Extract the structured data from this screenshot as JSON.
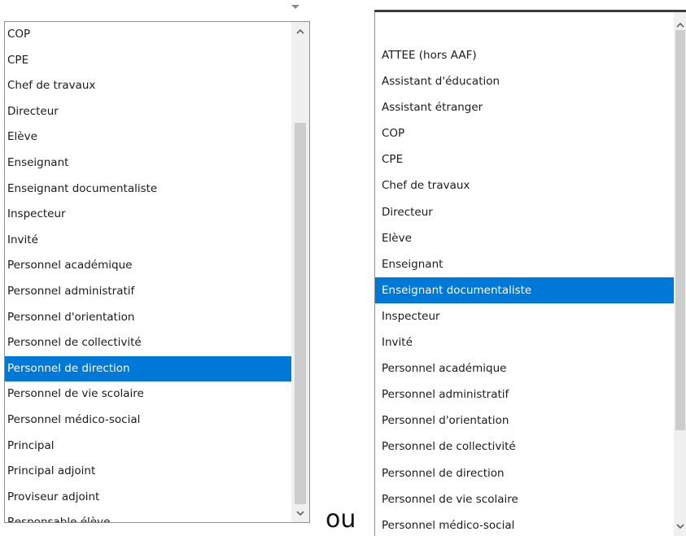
{
  "separator_text": "ou",
  "left_list": {
    "options": [
      "COP",
      "CPE",
      "Chef de travaux",
      "Directeur",
      "Elève",
      "Enseignant",
      "Enseignant documentaliste",
      "Inspecteur",
      "Invité",
      "Personnel académique",
      "Personnel administratif",
      "Personnel d'orientation",
      "Personnel de collectivité",
      "Personnel de direction",
      "Personnel de vie scolaire",
      "Personnel médico-social",
      "Principal",
      "Principal adjoint",
      "Proviseur adjoint",
      "Responsable élève"
    ],
    "selected_index": 13
  },
  "right_list": {
    "options": [
      "ATTEE (hors AAF)",
      "Assistant d'éducation",
      "Assistant étranger",
      "COP",
      "CPE",
      "Chef de travaux",
      "Directeur",
      "Elève",
      "Enseignant",
      "Enseignant documentaliste",
      "Inspecteur",
      "Invité",
      "Personnel académique",
      "Personnel administratif",
      "Personnel d'orientation",
      "Personnel de collectivité",
      "Personnel de direction",
      "Personnel de vie scolaire",
      "Personnel médico-social"
    ],
    "selected_index": 9
  },
  "colors": {
    "selection": "#0078d7",
    "selection_text": "#ffffff",
    "scrollbar_track": "#f0f0f0",
    "scrollbar_thumb": "#cdcdcd"
  },
  "icons": {
    "dropdown_arrow": "caret-down-icon",
    "scroll_up": "chevron-up-icon",
    "scroll_down": "chevron-down-icon"
  }
}
